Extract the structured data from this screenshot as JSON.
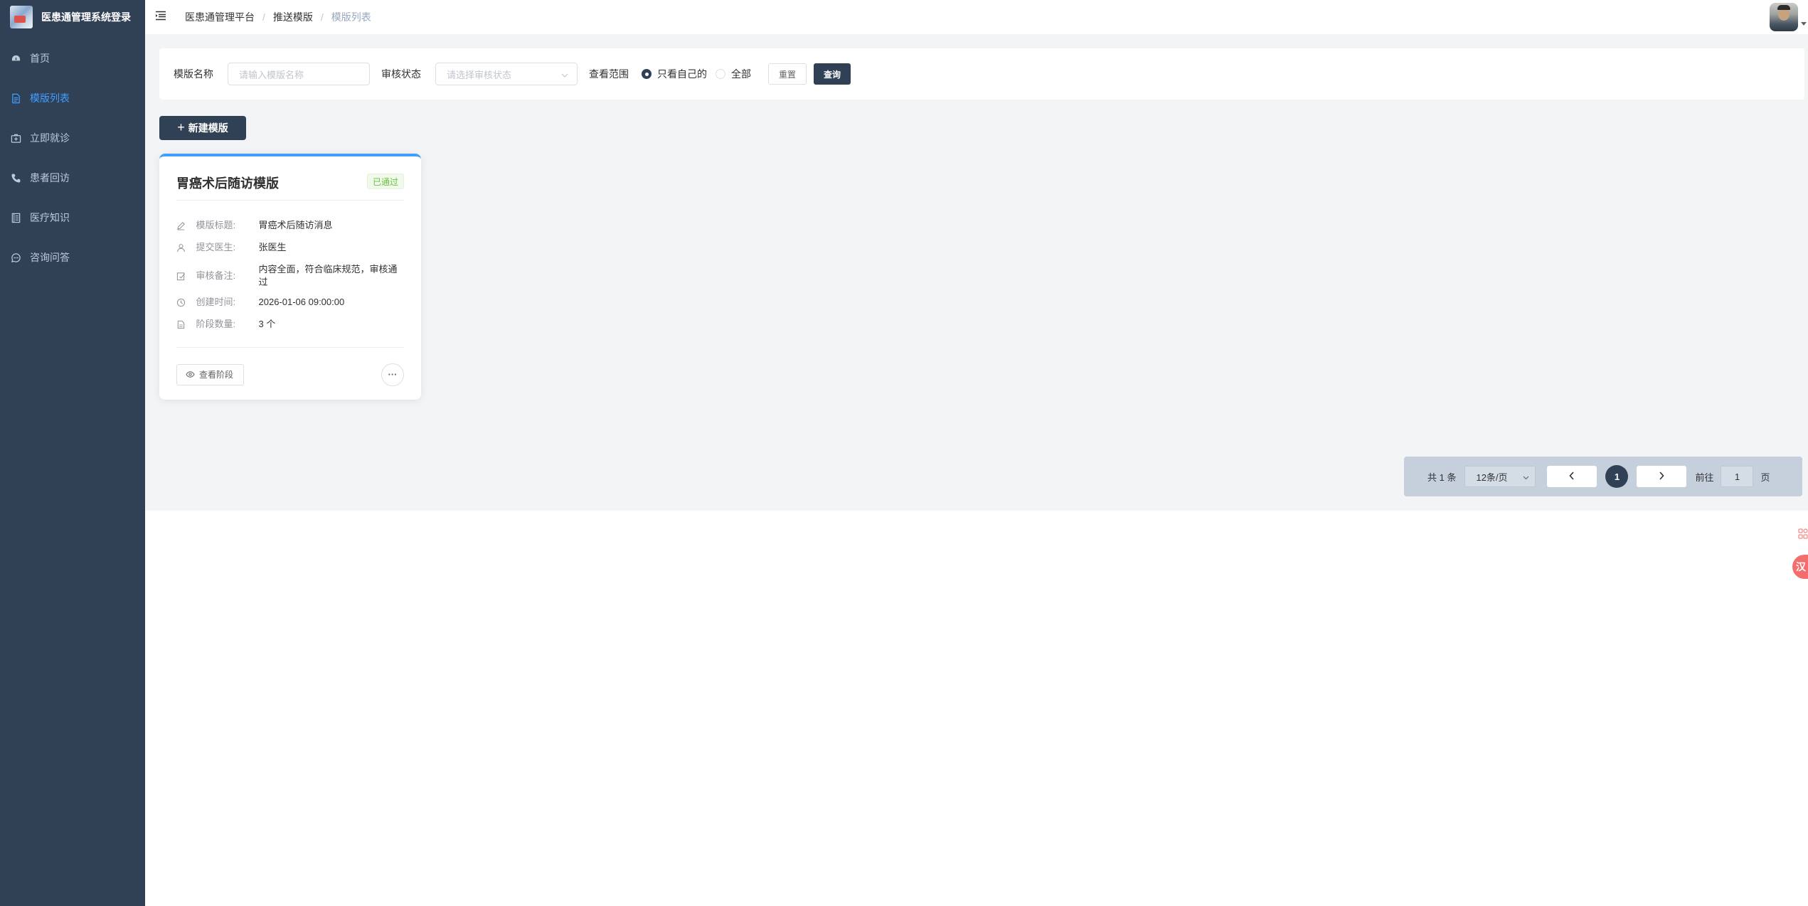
{
  "app": {
    "title": "医患通管理系统登录"
  },
  "sidebar": {
    "items": [
      {
        "label": "首页",
        "icon": "dashboard-icon",
        "active": false
      },
      {
        "label": "模版列表",
        "icon": "document-icon",
        "active": true
      },
      {
        "label": "立即就诊",
        "icon": "medical-kit-icon",
        "active": false
      },
      {
        "label": "患者回访",
        "icon": "phone-icon",
        "active": false
      },
      {
        "label": "医疗知识",
        "icon": "book-icon",
        "active": false
      },
      {
        "label": "咨询问答",
        "icon": "chat-icon",
        "active": false
      }
    ],
    "colors": {
      "background": "#304156",
      "text": "#bfcbd9",
      "active": "#409eff"
    }
  },
  "breadcrumb": [
    "医患通管理平台",
    "推送模版",
    "模版列表"
  ],
  "search": {
    "name_label": "模版名称",
    "name_placeholder": "请输入模版名称",
    "status_label": "审核状态",
    "status_placeholder": "请选择审核状态",
    "scope_label": "查看范围",
    "scope_options": [
      {
        "label": "只看自己的",
        "checked": true
      },
      {
        "label": "全部",
        "checked": false
      }
    ],
    "reset_label": "重置",
    "query_label": "查询"
  },
  "actions": {
    "new_label": "新建模版"
  },
  "templates": [
    {
      "title": "胃癌术后随访模版",
      "status": "已通过",
      "fields": [
        {
          "label": "模版标题:",
          "value": "胃癌术后随访消息",
          "icon": "edit-icon"
        },
        {
          "label": "提交医生:",
          "value": "张医生",
          "icon": "user-icon"
        },
        {
          "label": "审核备注:",
          "value": "内容全面，符合临床规范，审核通过",
          "icon": "review-icon"
        },
        {
          "label": "创建时间:",
          "value": "2026-01-06 09:00:00",
          "icon": "clock-icon"
        },
        {
          "label": "阶段数量:",
          "value": "3 个",
          "icon": "file-icon"
        }
      ],
      "view_label": "查看阶段",
      "more_label": "···"
    }
  ],
  "pagination": {
    "total_text": "共 1 条",
    "page_size": "12条/页",
    "current_page": "1",
    "goto_label": "前往",
    "goto_value": "1",
    "page_suffix": "页"
  },
  "floating": {
    "badge_text": "汉"
  },
  "colors": {
    "primary": "#304156",
    "accent": "#409eff",
    "success": "#67c23a",
    "page_bg": "#f3f4f6"
  }
}
